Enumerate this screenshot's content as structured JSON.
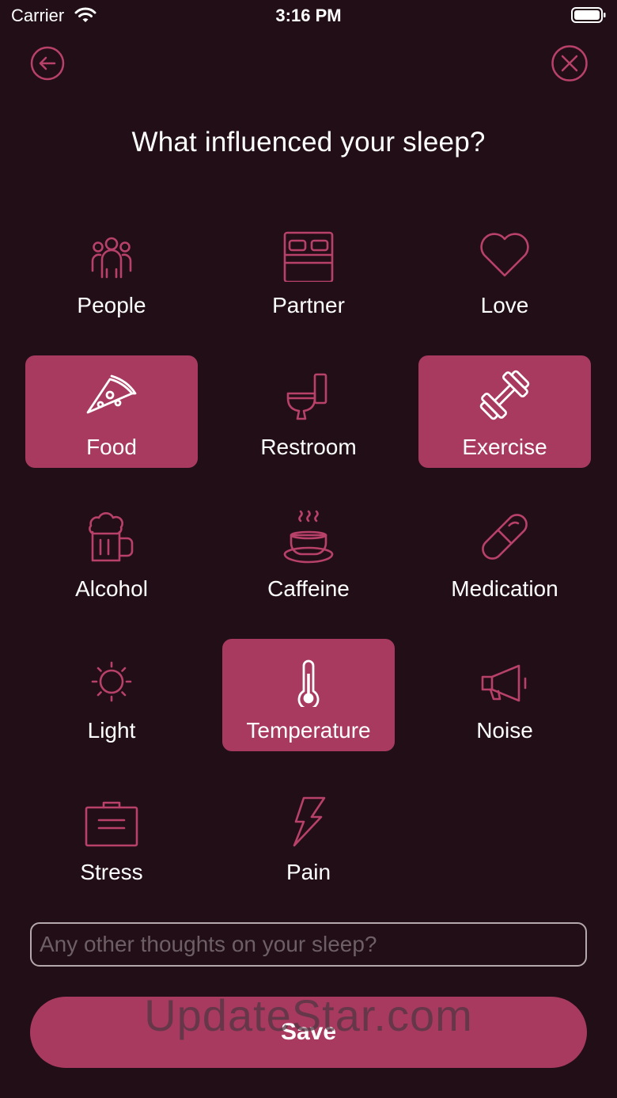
{
  "status_bar": {
    "carrier": "Carrier",
    "time": "3:16 PM"
  },
  "header": {
    "back_icon": "arrow-left-circle-icon",
    "close_icon": "x-circle-icon",
    "title": "What influenced your sleep?"
  },
  "colors": {
    "background": "#220e16",
    "accent": "#a83a60",
    "icon_stroke": "#b8416a"
  },
  "factors": [
    {
      "label": "People",
      "icon": "people-icon",
      "selected": false
    },
    {
      "label": "Partner",
      "icon": "bed-icon",
      "selected": false
    },
    {
      "label": "Love",
      "icon": "heart-icon",
      "selected": false
    },
    {
      "label": "Food",
      "icon": "pizza-slice-icon",
      "selected": true
    },
    {
      "label": "Restroom",
      "icon": "toilet-icon",
      "selected": false
    },
    {
      "label": "Exercise",
      "icon": "dumbbell-icon",
      "selected": true
    },
    {
      "label": "Alcohol",
      "icon": "beer-mug-icon",
      "selected": false
    },
    {
      "label": "Caffeine",
      "icon": "coffee-cup-icon",
      "selected": false
    },
    {
      "label": "Medication",
      "icon": "pill-icon",
      "selected": false
    },
    {
      "label": "Light",
      "icon": "sun-icon",
      "selected": false
    },
    {
      "label": "Temperature",
      "icon": "thermometer-icon",
      "selected": true
    },
    {
      "label": "Noise",
      "icon": "megaphone-icon",
      "selected": false
    },
    {
      "label": "Stress",
      "icon": "briefcase-icon",
      "selected": false
    },
    {
      "label": "Pain",
      "icon": "lightning-icon",
      "selected": false
    }
  ],
  "thoughts_input": {
    "placeholder": "Any other thoughts on your sleep?",
    "value": ""
  },
  "save_button": {
    "label": "Save"
  },
  "watermark": "UpdateStar.com"
}
